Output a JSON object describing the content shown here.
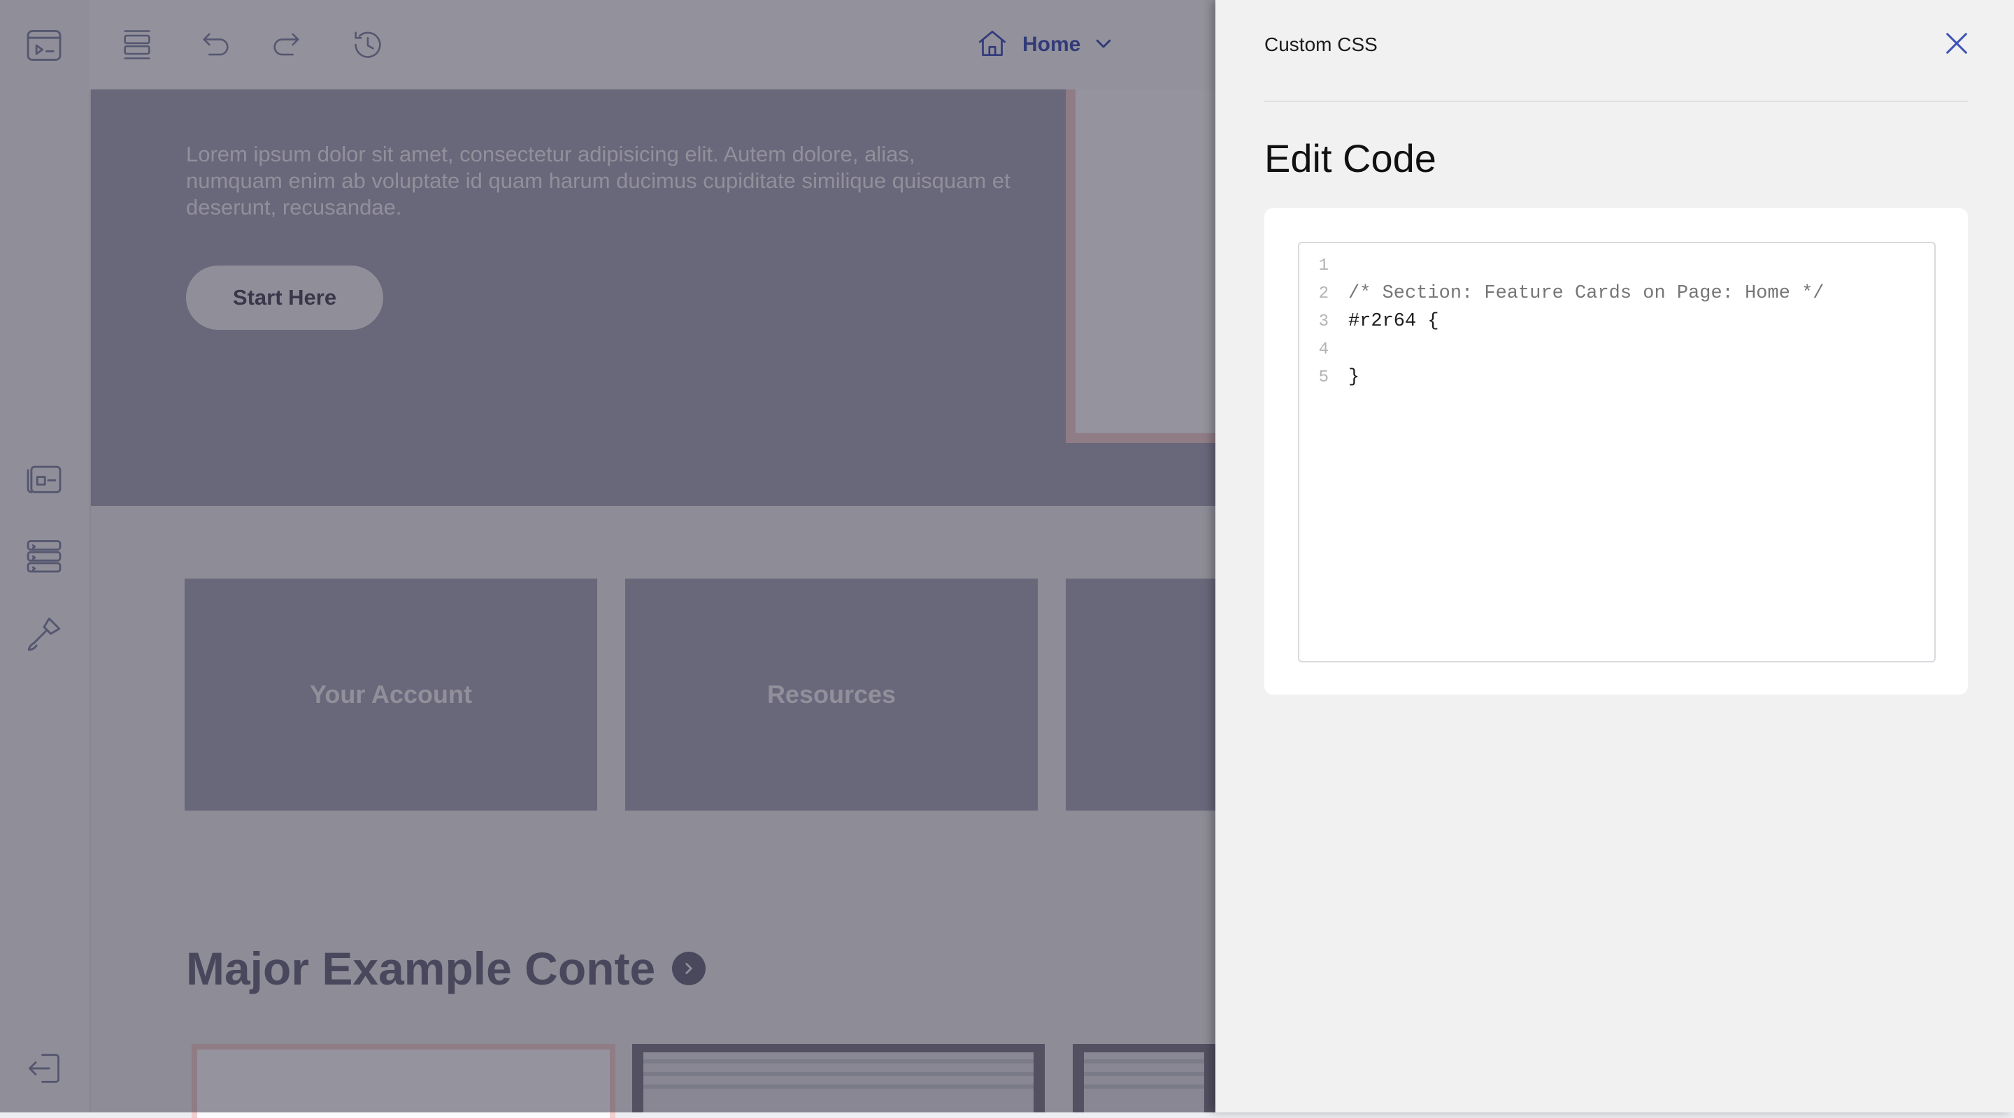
{
  "toolbar": {
    "page_selector_label": "Home"
  },
  "canvas": {
    "hero_text": "Lorem ipsum dolor sit amet, consectetur adipisicing elit. Autem dolore, alias, numquam enim ab voluptate id quam harum ducimus cupiditate similique quisquam et deserunt, recusandae.",
    "hero_button_label": "Start Here",
    "feature_cards": [
      {
        "label": "Your Account"
      },
      {
        "label": "Resources"
      },
      {
        "label": ""
      }
    ],
    "section_heading": "Major Example Conte"
  },
  "panel": {
    "title": "Custom CSS",
    "heading": "Edit Code",
    "code_lines": [
      {
        "num": "1",
        "text": ""
      },
      {
        "num": "2",
        "text": "/* Section: Feature Cards on Page: Home */"
      },
      {
        "num": "3",
        "text": "#r2r64 {"
      },
      {
        "num": "4",
        "text": ""
      },
      {
        "num": "5",
        "text": "}"
      }
    ]
  },
  "icons": {
    "rail": [
      "preview-icon",
      "layouts-icon",
      "forms-icon",
      "brush-icon",
      "exit-icon"
    ],
    "toolbar": [
      "sections-icon",
      "undo-icon",
      "redo-icon",
      "history-icon",
      "home-icon",
      "chevron-down-icon",
      "close-icon"
    ]
  },
  "colors": {
    "accent": "#3e52b8",
    "hero_background": "#a7a7ba",
    "panel_background": "#f0f1f0",
    "overlay": "rgba(38,34,52,0.48)"
  }
}
